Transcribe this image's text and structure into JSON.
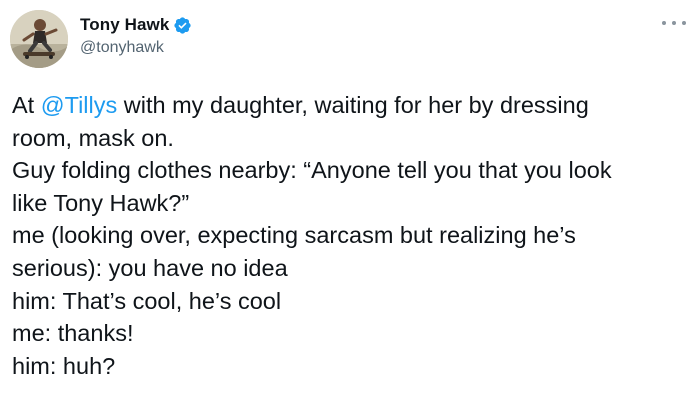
{
  "author": {
    "display_name": "Tony Hawk",
    "handle": "@tonyhawk",
    "verified": true
  },
  "icons": {
    "verified": "verified-badge-icon",
    "more": "more-horizontal-icon",
    "avatar": "profile-avatar"
  },
  "colors": {
    "mention": "#1d9bf0",
    "verified": "#1d9bf0",
    "text": "#0f1419",
    "secondary": "#536471"
  },
  "tweet": {
    "line1_prefix": "At ",
    "mention": "@Tillys",
    "line1_suffix": " with my daughter, waiting for her by dressing",
    "line2": "room, mask on.",
    "line3": "Guy folding clothes nearby: “Anyone tell you that you look",
    "line4": "like Tony Hawk?”",
    "line5": "me (looking over, expecting sarcasm but realizing he’s",
    "line6": "serious): you have no idea",
    "line7": "him: That’s cool, he’s cool",
    "line8": "me: thanks!",
    "line9": "him: huh?"
  }
}
